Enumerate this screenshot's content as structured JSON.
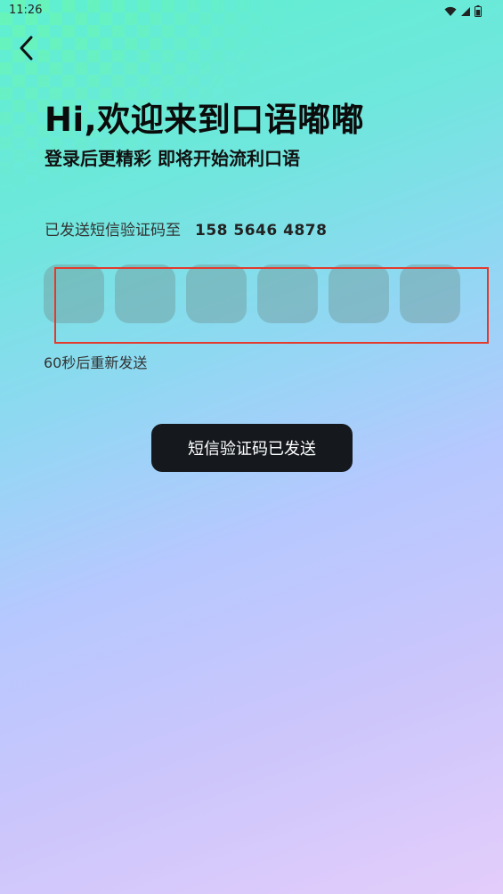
{
  "status_bar": {
    "time": "11:26",
    "icons": [
      "wifi-icon",
      "signal-icon",
      "battery-icon"
    ]
  },
  "header": {
    "back_icon": "chevron-left-icon",
    "title": "Hi,欢迎来到口语嘟嘟",
    "subtitle": "登录后更精彩 即将开始流利口语"
  },
  "verification": {
    "sent_label": "已发送短信验证码至",
    "phone_number": "158 5646 4878",
    "code_digits": [
      "",
      "",
      "",
      "",
      "",
      ""
    ],
    "resend_label": "60秒后重新发送"
  },
  "toast": {
    "message": "短信验证码已发送"
  },
  "colors": {
    "highlight_box": "#e23b2e",
    "toast_bg": "#15191e",
    "gradient_start": "#5ef0cf",
    "gradient_end": "#e3cdfb"
  }
}
